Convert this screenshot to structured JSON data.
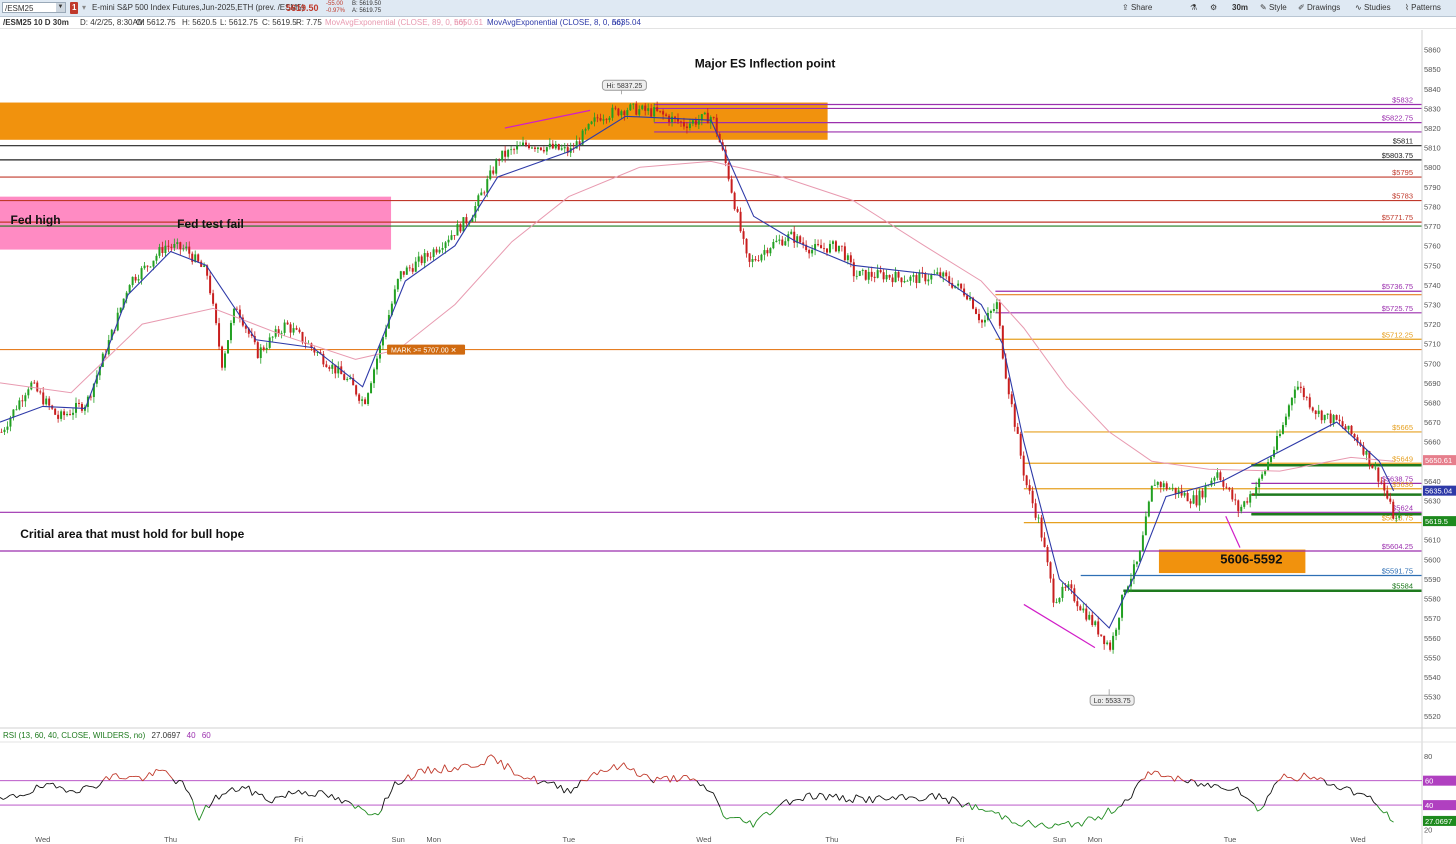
{
  "toolbar": {
    "symbol": "/ESM25",
    "alert_badge": "1",
    "description": "E-mini S&P 500 Index Futures,Jun-2025,ETH (prev. /ESM5)",
    "last_price": "5619.50",
    "change": "-55.00",
    "change_pct": "-0.97%",
    "bid": "B: 5619.50",
    "ask": "A: 5619.75",
    "share_label": "Share",
    "timeframe_label": "30m",
    "style_label": "Style",
    "drawings_label": "Drawings",
    "studies_label": "Studies",
    "patterns_label": "Patterns"
  },
  "infobar": {
    "chart_symbol": "/ESM25 10 D 30m",
    "date": "D: 4/2/25, 8:30AM",
    "open": "O: 5612.75",
    "high": "H: 5620.5",
    "low": "L: 5612.75",
    "close": "C: 5619.5",
    "range": "R: 7.75",
    "ema89_label": "MovAvgExponential (CLOSE, 89, 0, no)",
    "ema89_value": "5650.61",
    "ema8_label": "MovAvgExponential (CLOSE, 8, 0, no)",
    "ema8_value": "5635.04"
  },
  "chart_data": {
    "type": "candlestick",
    "symbol": "/ESM25",
    "interval": "30m",
    "ylim": [
      5515,
      5870
    ],
    "y_ticks": [
      5520,
      5530,
      5540,
      5550,
      5560,
      5570,
      5580,
      5590,
      5600,
      5610,
      5620,
      5630,
      5640,
      5650,
      5660,
      5670,
      5680,
      5690,
      5700,
      5710,
      5720,
      5730,
      5740,
      5750,
      5760,
      5770,
      5780,
      5790,
      5800,
      5810,
      5820,
      5830,
      5840,
      5850,
      5860
    ],
    "x_day_labels": [
      "Wed",
      "Thu",
      "Fri",
      "Sun",
      "Mon",
      "Tue",
      "Wed",
      "Thu",
      "Fri",
      "Sun",
      "Mon",
      "Tue",
      "Wed"
    ],
    "x_day_positions": [
      0.03,
      0.12,
      0.21,
      0.28,
      0.305,
      0.4,
      0.495,
      0.585,
      0.675,
      0.745,
      0.77,
      0.865,
      0.955
    ],
    "price_path": [
      [
        0,
        5665
      ],
      [
        0.02,
        5690
      ],
      [
        0.04,
        5672
      ],
      [
        0.06,
        5680
      ],
      [
        0.08,
        5720
      ],
      [
        0.09,
        5742
      ],
      [
        0.1,
        5748
      ],
      [
        0.115,
        5760
      ],
      [
        0.13,
        5758
      ],
      [
        0.145,
        5745
      ],
      [
        0.155,
        5700
      ],
      [
        0.165,
        5730
      ],
      [
        0.18,
        5705
      ],
      [
        0.2,
        5720
      ],
      [
        0.23,
        5700
      ],
      [
        0.245,
        5690
      ],
      [
        0.255,
        5680
      ],
      [
        0.265,
        5705
      ],
      [
        0.28,
        5745
      ],
      [
        0.3,
        5755
      ],
      [
        0.33,
        5775
      ],
      [
        0.35,
        5805
      ],
      [
        0.37,
        5812
      ],
      [
        0.4,
        5808
      ],
      [
        0.42,
        5826
      ],
      [
        0.44,
        5830
      ],
      [
        0.46,
        5828
      ],
      [
        0.48,
        5822
      ],
      [
        0.5,
        5826
      ],
      [
        0.51,
        5800
      ],
      [
        0.525,
        5750
      ],
      [
        0.54,
        5760
      ],
      [
        0.555,
        5765
      ],
      [
        0.57,
        5758
      ],
      [
        0.59,
        5760
      ],
      [
        0.6,
        5745
      ],
      [
        0.62,
        5745
      ],
      [
        0.64,
        5743
      ],
      [
        0.66,
        5745
      ],
      [
        0.68,
        5735
      ],
      [
        0.69,
        5720
      ],
      [
        0.7,
        5730
      ],
      [
        0.705,
        5700
      ],
      [
        0.72,
        5640
      ],
      [
        0.73,
        5618
      ],
      [
        0.74,
        5580
      ],
      [
        0.75,
        5585
      ],
      [
        0.765,
        5570
      ],
      [
        0.78,
        5555
      ],
      [
        0.79,
        5585
      ],
      [
        0.8,
        5600
      ],
      [
        0.81,
        5640
      ],
      [
        0.825,
        5635
      ],
      [
        0.84,
        5630
      ],
      [
        0.855,
        5645
      ],
      [
        0.87,
        5625
      ],
      [
        0.885,
        5640
      ],
      [
        0.9,
        5665
      ],
      [
        0.91,
        5690
      ],
      [
        0.925,
        5675
      ],
      [
        0.94,
        5670
      ],
      [
        0.955,
        5660
      ],
      [
        0.97,
        5640
      ],
      [
        0.98,
        5620
      ]
    ],
    "ema8_path": [
      [
        0,
        5670
      ],
      [
        0.03,
        5678
      ],
      [
        0.06,
        5677
      ],
      [
        0.09,
        5735
      ],
      [
        0.12,
        5757
      ],
      [
        0.145,
        5750
      ],
      [
        0.18,
        5712
      ],
      [
        0.22,
        5708
      ],
      [
        0.255,
        5688
      ],
      [
        0.285,
        5742
      ],
      [
        0.32,
        5760
      ],
      [
        0.35,
        5795
      ],
      [
        0.4,
        5808
      ],
      [
        0.44,
        5826
      ],
      [
        0.5,
        5824
      ],
      [
        0.53,
        5775
      ],
      [
        0.56,
        5762
      ],
      [
        0.6,
        5750
      ],
      [
        0.66,
        5745
      ],
      [
        0.69,
        5730
      ],
      [
        0.705,
        5710
      ],
      [
        0.72,
        5660
      ],
      [
        0.745,
        5590
      ],
      [
        0.78,
        5565
      ],
      [
        0.8,
        5595
      ],
      [
        0.82,
        5632
      ],
      [
        0.86,
        5640
      ],
      [
        0.9,
        5655
      ],
      [
        0.94,
        5670
      ],
      [
        0.97,
        5650
      ],
      [
        0.98,
        5635
      ]
    ],
    "ema89_path": [
      [
        0,
        5690
      ],
      [
        0.05,
        5685
      ],
      [
        0.1,
        5720
      ],
      [
        0.15,
        5728
      ],
      [
        0.2,
        5714
      ],
      [
        0.25,
        5702
      ],
      [
        0.28,
        5707
      ],
      [
        0.32,
        5730
      ],
      [
        0.36,
        5762
      ],
      [
        0.4,
        5785
      ],
      [
        0.45,
        5800
      ],
      [
        0.5,
        5803
      ],
      [
        0.55,
        5795
      ],
      [
        0.6,
        5783
      ],
      [
        0.65,
        5760
      ],
      [
        0.69,
        5742
      ],
      [
        0.72,
        5718
      ],
      [
        0.75,
        5688
      ],
      [
        0.78,
        5665
      ],
      [
        0.81,
        5650
      ],
      [
        0.85,
        5646
      ],
      [
        0.9,
        5645
      ],
      [
        0.95,
        5652
      ],
      [
        0.98,
        5650
      ]
    ],
    "high": {
      "label": "Hi: 5837.25",
      "x": 0.437,
      "value": 5837.25
    },
    "low": {
      "label": "Lo: 5533.75",
      "x": 0.78,
      "value": 5533.75
    },
    "levels": [
      {
        "value": 5832,
        "label": "$5832",
        "color": "#9b2fae",
        "x0": 0.46
      },
      {
        "value": 5830,
        "label": "",
        "color": "#9b2fae",
        "x0": 0.46
      },
      {
        "value": 5822.75,
        "label": "$5822.75",
        "color": "#9b2fae",
        "x0": 0.46
      },
      {
        "value": 5818,
        "label": "",
        "color": "#9b2fae",
        "x0": 0.46
      },
      {
        "value": 5811,
        "label": "$5811",
        "color": "#222222",
        "x0": 0.0
      },
      {
        "value": 5803.75,
        "label": "$5803.75",
        "color": "#222222",
        "x0": 0.0
      },
      {
        "value": 5795,
        "label": "$5795",
        "color": "#c0392b",
        "x0": 0.0
      },
      {
        "value": 5783,
        "label": "$5783",
        "color": "#c0392b",
        "x0": 0.0
      },
      {
        "value": 5772,
        "label": "$5771.75",
        "color": "#c0392b",
        "x0": 0.0
      },
      {
        "value": 5770,
        "label": "",
        "color": "#1e7a1e",
        "x0": 0.0
      },
      {
        "value": 5736.75,
        "label": "$5736.75",
        "color": "#9b2fae",
        "x0": 0.7
      },
      {
        "value": 5735,
        "label": "",
        "color": "#e67e22",
        "x0": 0.7
      },
      {
        "value": 5725.75,
        "label": "$5725.75",
        "color": "#9b2fae",
        "x0": 0.7
      },
      {
        "value": 5712.25,
        "label": "$5712.25",
        "color": "#e6a020",
        "x0": 0.7
      },
      {
        "value": 5707,
        "label": "",
        "color": "#e67e22",
        "x0": 0.0
      },
      {
        "value": 5665,
        "label": "$5665",
        "color": "#e6a020",
        "x0": 0.72
      },
      {
        "value": 5649,
        "label": "$5649",
        "color": "#e6a020",
        "x0": 0.72
      },
      {
        "value": 5648,
        "label": "",
        "color": "#1e7a1e",
        "x0": 0.88
      },
      {
        "value": 5638.75,
        "label": "$5638.75",
        "color": "#9b2fae",
        "x0": 0.88
      },
      {
        "value": 5636,
        "label": "$5636",
        "color": "#e6a020",
        "x0": 0.72
      },
      {
        "value": 5633,
        "label": "",
        "color": "#1e7a1e",
        "x0": 0.88
      },
      {
        "value": 5624,
        "label": "$5624",
        "color": "#9b2fae",
        "x0": 0.0
      },
      {
        "value": 5623,
        "label": "",
        "color": "#1e7a1e",
        "x0": 0.88
      },
      {
        "value": 5618.75,
        "label": "$5618.75",
        "color": "#e6a020",
        "x0": 0.72
      },
      {
        "value": 5604.25,
        "label": "$5604.25",
        "color": "#9b2fae",
        "x0": 0.0
      },
      {
        "value": 5591.75,
        "label": "$5591.75",
        "color": "#2e6fb5",
        "x0": 0.76
      },
      {
        "value": 5584,
        "label": "$5584",
        "color": "#1e7a1e",
        "x0": 0.79
      }
    ],
    "zones": [
      {
        "y0": 5833,
        "y1": 5814,
        "x0": 0.0,
        "x1": 0.582,
        "color": "#f08c00"
      },
      {
        "y0": 5785,
        "y1": 5758,
        "x0": 0.0,
        "x1": 0.275,
        "color": "#ff85c0"
      },
      {
        "y0": 5605,
        "y1": 5593,
        "x0": 0.815,
        "x1": 0.918,
        "color": "#f08c00"
      }
    ],
    "annotations": [
      {
        "text": "Major ES Inflection point",
        "x": 0.538,
        "value": 5851,
        "bold": true
      },
      {
        "text": "Fed high",
        "x": 0.025,
        "value": 5771,
        "bold": true
      },
      {
        "text": "Fed test fail",
        "x": 0.148,
        "value": 5769,
        "bold": true
      },
      {
        "text": "Critial area that must hold for bull hope",
        "x": 0.093,
        "value": 5611,
        "bold": true
      },
      {
        "text": "5606-5592",
        "x": 0.88,
        "value": 5598,
        "bold": true
      }
    ],
    "price_tags": [
      {
        "label": "5650.61",
        "value": 5650.61,
        "color": "#e67e8c"
      },
      {
        "label": "5635.04",
        "value": 5635.04,
        "color": "#2e3aa8"
      },
      {
        "label": "5619.5",
        "value": 5619.5,
        "color": "#1e8a1e"
      }
    ],
    "mark": {
      "label": "MARK >= 5707.00 ✕",
      "value": 5707,
      "x": 0.275
    },
    "rsi": {
      "label": "RSI (13, 60, 40, CLOSE, WILDERS, no)",
      "value": "27.0697",
      "overbought": "60",
      "oversold": "40",
      "ylim": [
        18,
        90
      ],
      "ticks": [
        20,
        40,
        60,
        80
      ],
      "path": [
        [
          0,
          43
        ],
        [
          0.03,
          55
        ],
        [
          0.06,
          53
        ],
        [
          0.08,
          64
        ],
        [
          0.1,
          62
        ],
        [
          0.115,
          68
        ],
        [
          0.13,
          55
        ],
        [
          0.14,
          30
        ],
        [
          0.15,
          45
        ],
        [
          0.17,
          55
        ],
        [
          0.19,
          44
        ],
        [
          0.21,
          52
        ],
        [
          0.23,
          48
        ],
        [
          0.25,
          38
        ],
        [
          0.265,
          33
        ],
        [
          0.28,
          60
        ],
        [
          0.3,
          68
        ],
        [
          0.33,
          72
        ],
        [
          0.345,
          78
        ],
        [
          0.37,
          63
        ],
        [
          0.4,
          52
        ],
        [
          0.42,
          68
        ],
        [
          0.44,
          72
        ],
        [
          0.46,
          60
        ],
        [
          0.48,
          63
        ],
        [
          0.5,
          52
        ],
        [
          0.51,
          30
        ],
        [
          0.53,
          25
        ],
        [
          0.55,
          42
        ],
        [
          0.57,
          48
        ],
        [
          0.6,
          45
        ],
        [
          0.63,
          45
        ],
        [
          0.66,
          47
        ],
        [
          0.68,
          40
        ],
        [
          0.7,
          33
        ],
        [
          0.72,
          25
        ],
        [
          0.74,
          22
        ],
        [
          0.77,
          28
        ],
        [
          0.79,
          42
        ],
        [
          0.81,
          68
        ],
        [
          0.83,
          60
        ],
        [
          0.85,
          56
        ],
        [
          0.87,
          55
        ],
        [
          0.885,
          35
        ],
        [
          0.9,
          63
        ],
        [
          0.92,
          63
        ],
        [
          0.94,
          56
        ],
        [
          0.96,
          48
        ],
        [
          0.97,
          38
        ],
        [
          0.98,
          27
        ]
      ]
    }
  }
}
